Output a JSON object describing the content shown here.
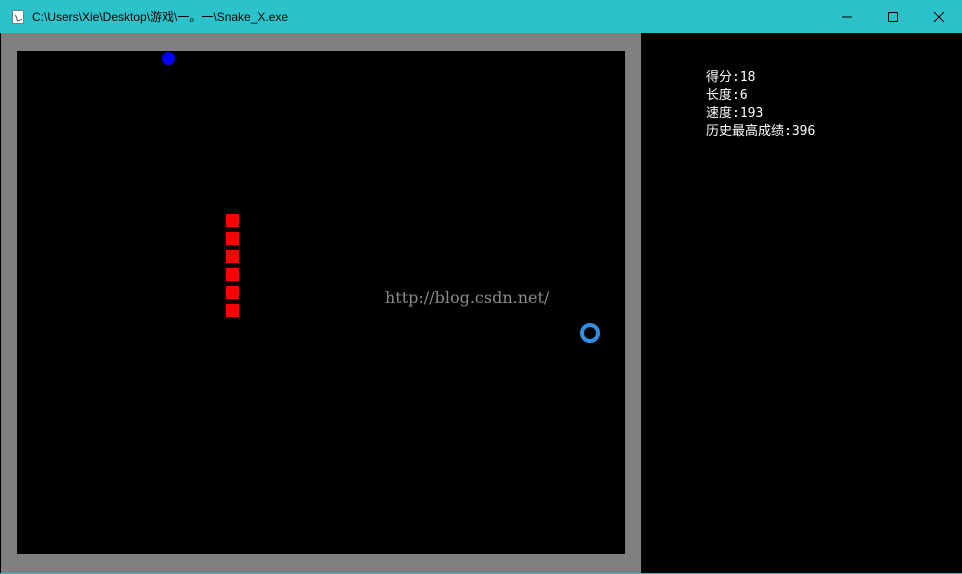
{
  "window": {
    "title": "C:\\Users\\Xie\\Desktop\\游戏\\一。一\\Snake_X.exe",
    "icon": "app-icon"
  },
  "controls": {
    "minimize": "minimize-icon",
    "maximize": "maximize-icon",
    "close": "close-icon"
  },
  "game": {
    "snake_length_segments": 6,
    "food_color": "#0000ff",
    "snake_color": "#ff0000",
    "bonus_ring_color": "#2f8ee6"
  },
  "watermark": "http://blog.csdn.net/",
  "stats": {
    "score_label": "得分:",
    "score_value": "18",
    "length_label": "长度:",
    "length_value": "6",
    "speed_label": "速度:",
    "speed_value": "193",
    "best_label": "历史最高成绩:",
    "best_value": "396"
  }
}
